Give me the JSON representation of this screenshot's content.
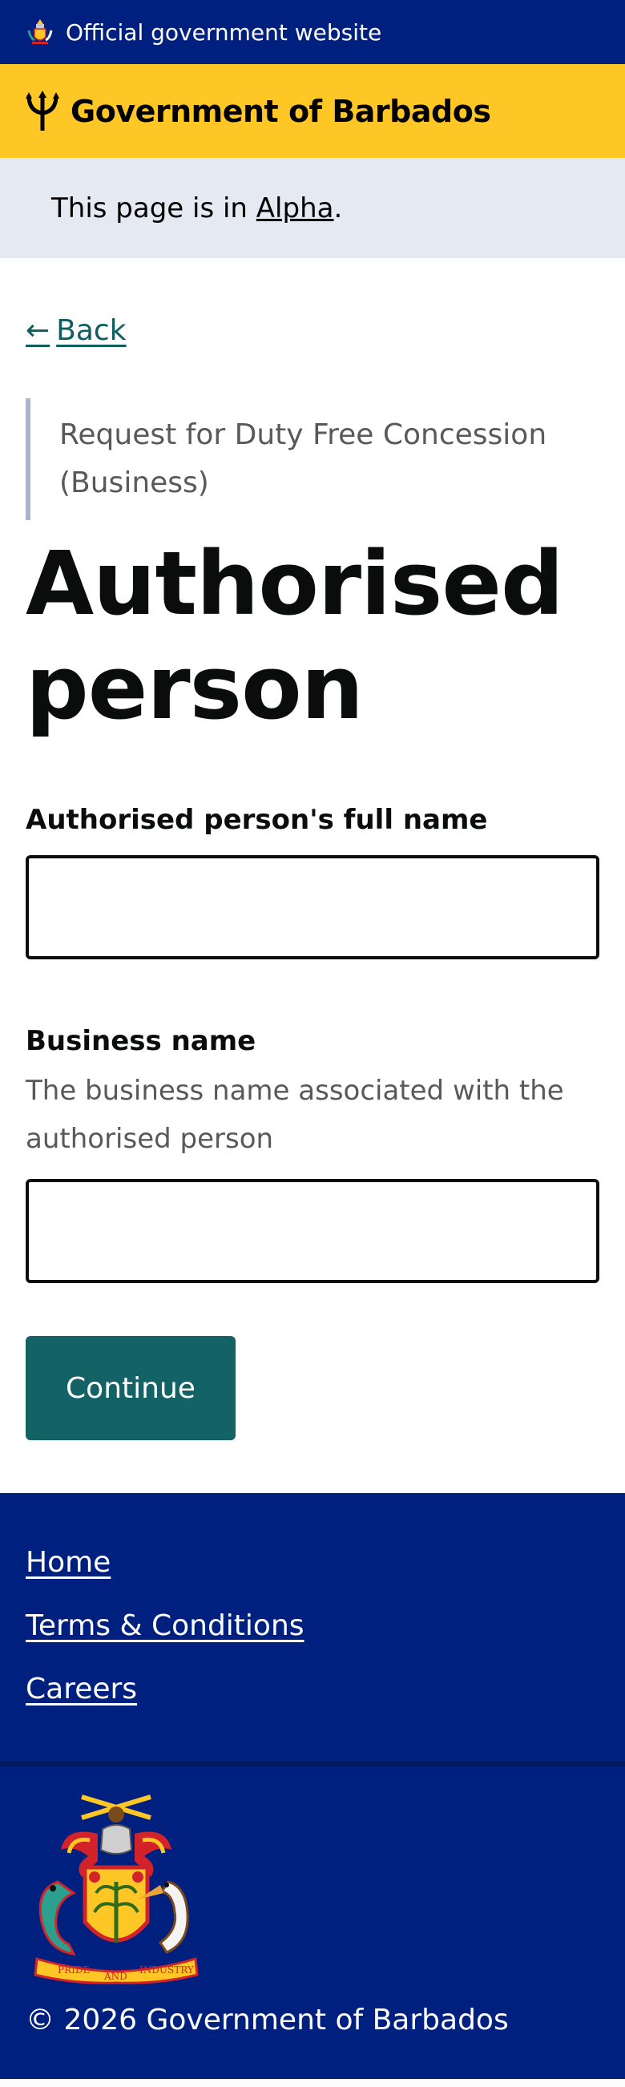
{
  "official_bar": {
    "text": "Official government website",
    "icon": "coat-of-arms-icon"
  },
  "header": {
    "title": "Government of Barbados",
    "icon": "trident-icon",
    "bg": "#ffc726"
  },
  "phase_banner": {
    "prefix": "This page is in ",
    "link_text": "Alpha",
    "suffix": "."
  },
  "back_link": {
    "label": "Back",
    "icon": "arrow-left-icon"
  },
  "form": {
    "caption": "Request for Duty Free Concession (Business)",
    "title": "Authorised person",
    "fields": [
      {
        "label": "Authorised person's full name",
        "hint": "",
        "value": ""
      },
      {
        "label": "Business name",
        "hint": "The business name associated with the authorised person",
        "value": ""
      }
    ],
    "submit_label": "Continue"
  },
  "footer": {
    "links": [
      "Home",
      "Terms & Conditions",
      "Careers"
    ],
    "crest_motto": [
      "PRIDE",
      "AND",
      "INDUSTRY"
    ],
    "copyright": "© 2026 Government of Barbados"
  },
  "colors": {
    "navy": "#00207f",
    "gold": "#ffc726",
    "teal": "#136366",
    "link": "#0e5d61",
    "banner": "#e5e9f2"
  }
}
